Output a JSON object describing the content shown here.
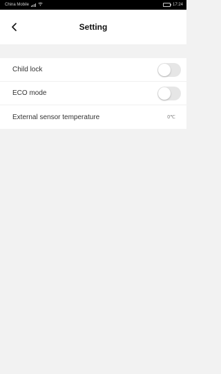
{
  "status_bar": {
    "carrier": "China Mobile",
    "time": "17:24"
  },
  "header": {
    "title": "Setting",
    "back_icon": "chevron-left-icon"
  },
  "settings": [
    {
      "label": "Child lock",
      "type": "toggle",
      "enabled": false
    },
    {
      "label": "ECO mode",
      "type": "toggle",
      "enabled": false
    },
    {
      "label": "External sensor temperature",
      "type": "value",
      "value": "0℃"
    }
  ],
  "colors": {
    "background": "#f2f2f2",
    "surface": "#ffffff",
    "toggle_off": "#e6e6e6",
    "status_bar": "#000000"
  }
}
